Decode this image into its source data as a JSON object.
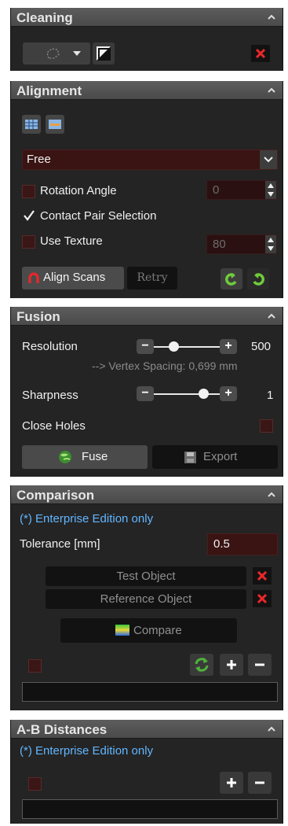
{
  "cleaning": {
    "title": "Cleaning"
  },
  "alignment": {
    "title": "Alignment",
    "mode_select": "Free",
    "rotation_angle_label": "Rotation Angle",
    "rotation_angle_value": "0",
    "rotation_angle_checked": false,
    "contact_pair_label": "Contact Pair Selection",
    "contact_pair_checked": true,
    "use_texture_label": "Use Texture",
    "use_texture_value": "80",
    "use_texture_checked": false,
    "align_scans_label": "Align Scans",
    "retry_label": "Retry"
  },
  "fusion": {
    "title": "Fusion",
    "resolution_label": "Resolution",
    "resolution_value": "500",
    "resolution_level": 0.3,
    "vertex_spacing": "--> Vertex Spacing: 0,699 mm",
    "sharpness_label": "Sharpness",
    "sharpness_value": "1",
    "sharpness_level": 0.75,
    "close_holes_label": "Close Holes",
    "close_holes_checked": false,
    "fuse_label": "Fuse",
    "export_label": "Export"
  },
  "comparison": {
    "title": "Comparison",
    "note": "(*) Enterprise Edition only",
    "tolerance_label": "Tolerance [mm]",
    "tolerance_value": "0.5",
    "test_object_label": "Test Object",
    "reference_object_label": "Reference Object",
    "compare_label": "Compare"
  },
  "ab_distances": {
    "title": "A-B Distances",
    "note": "(*) Enterprise Edition only"
  },
  "colors": {
    "accent_red": "#e8272a",
    "panel_bg": "#242424",
    "note_blue": "#62b6ff",
    "green_icon": "#4fb33a"
  }
}
